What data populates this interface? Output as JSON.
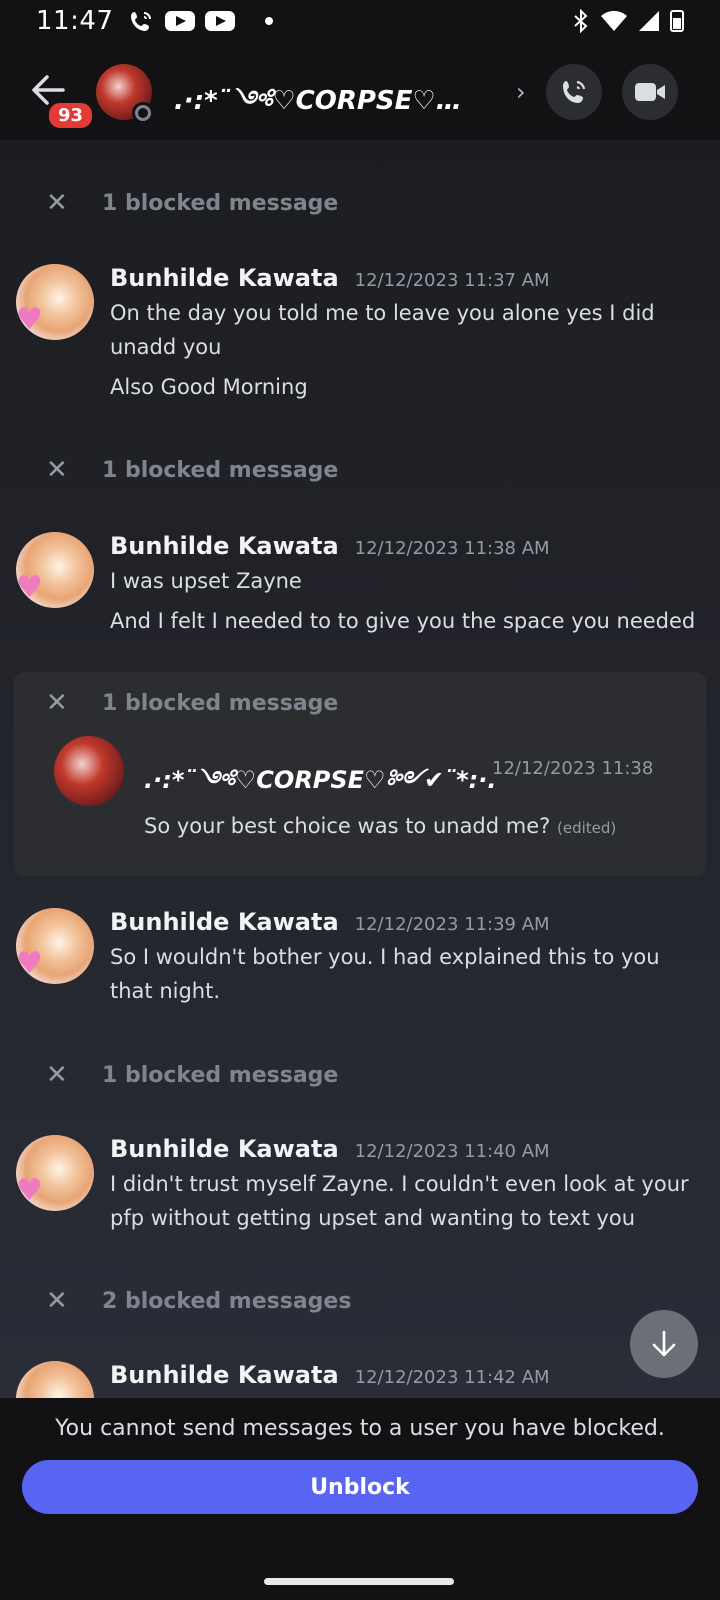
{
  "status_bar": {
    "time": "11:47",
    "icons": [
      "phone-wifi-icon",
      "youtube-icon",
      "youtube-icon",
      "dot",
      "bluetooth-icon",
      "wifi-icon",
      "signal-icon",
      "battery-icon"
    ]
  },
  "header": {
    "unread_badge": "93",
    "channel_name": ".·:*¨༺♡CORPSE♡…",
    "chevron": "›"
  },
  "blocked_rows": [
    {
      "label": "1 blocked message"
    },
    {
      "label": "1 blocked message"
    },
    {
      "label": "1 blocked message"
    },
    {
      "label": "1 blocked message"
    },
    {
      "label": "2 blocked messages"
    }
  ],
  "messages": [
    {
      "author": "Bunhilde Kawata",
      "timestamp": "12/12/2023 11:37 AM",
      "lines": [
        "On the day you told me to leave you alone yes I did unadd you",
        "Also Good Morning"
      ]
    },
    {
      "author": "Bunhilde Kawata",
      "timestamp": "12/12/2023 11:38 AM",
      "lines": [
        "I was upset Zayne",
        "And I felt I needed to to give you the space you needed"
      ]
    },
    {
      "author": "Bunhilde Kawata",
      "timestamp": "12/12/2023 11:39 AM",
      "lines": [
        "So I wouldn't bother you. I had explained this to you that night."
      ]
    },
    {
      "author": "Bunhilde Kawata",
      "timestamp": "12/12/2023 11:40 AM",
      "lines": [
        "I didn't trust myself Zayne. I couldn't even look at your pfp without getting upset and wanting to text you"
      ]
    },
    {
      "author": "Bunhilde Kawata",
      "timestamp": "12/12/2023 11:42 AM",
      "lines": []
    }
  ],
  "revealed_message": {
    "author": ".·:*¨༺♡CORPSE♡༻✔¨*:·.",
    "timestamp": "12/12/2023 11:38",
    "text": "So your best choice was to unadd me?",
    "edited": "(edited)"
  },
  "footer": {
    "notice": "You cannot send messages to a user you have blocked.",
    "unblock_label": "Unblock"
  },
  "colors": {
    "accent": "#5865f2",
    "badge": "#e53935",
    "background": "#1a1a1e",
    "header": "#121214"
  }
}
